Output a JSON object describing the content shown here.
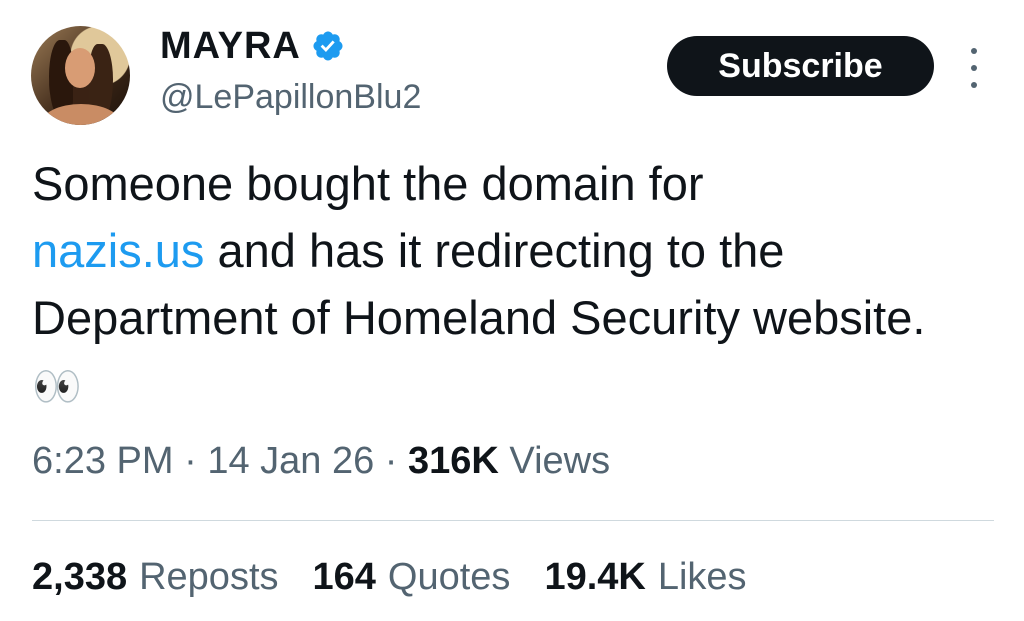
{
  "author": {
    "display_name": "MAYRA",
    "handle": "@LePapillonBlu2",
    "verified": true,
    "verified_color": "#1d9bf0"
  },
  "actions": {
    "subscribe_label": "Subscribe",
    "more_icon": "more-vertical-icon"
  },
  "tweet": {
    "text_before_link": "Someone bought the domain for",
    "link_text": "nazis.us",
    "link_color": "#1d9bf0",
    "text_after_link": " and has it redirecting to the Department of Homeland Security website. ",
    "emoji": "👀"
  },
  "meta": {
    "time": "6:23 PM",
    "date": "14 Jan 26",
    "views_count": "316K",
    "views_label": "Views",
    "separator": "·"
  },
  "stats": [
    {
      "count": "2,338",
      "label": "Reposts"
    },
    {
      "count": "164",
      "label": "Quotes"
    },
    {
      "count": "19.4K",
      "label": "Likes"
    }
  ]
}
